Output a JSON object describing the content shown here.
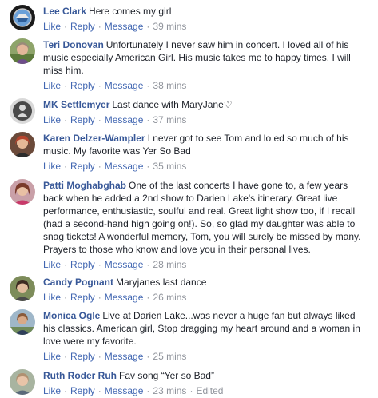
{
  "labels": {
    "like": "Like",
    "reply": "Reply",
    "message": "Message",
    "separator": "·"
  },
  "comments": [
    {
      "author": "Lee Clark",
      "text": "Here comes my girl",
      "time": "39 mins",
      "edited": "",
      "avatar": "lee-clark"
    },
    {
      "author": "Teri Donovan",
      "text": "Unfortunately I never saw him in concert. I loved all of his music especially American Girl. His music takes me to happy times. I will miss him.",
      "time": "38 mins",
      "edited": "",
      "avatar": "teri-donovan"
    },
    {
      "author": "MK Settlemyer",
      "text": "Last dance with MaryJane♡",
      "time": "37 mins",
      "edited": "",
      "avatar": "mk-settlemyer"
    },
    {
      "author": "Karen Delzer-Wampler",
      "text": "I never got to see Tom and lo ed so much of his music. My favorite was Yer So Bad",
      "time": "35 mins",
      "edited": "",
      "avatar": "karen-delzer-wampler"
    },
    {
      "author": "Patti Moghabghab",
      "text": "One of the last concerts I have gone to, a few years back when he added a 2nd show to Darien Lake's itinerary. Great live performance, enthusiastic, soulful and real. Great light show too, if I recall (had a second-hand high going on!). So, so glad my daughter was able to snag tickets! A wonderful memory, Tom, you will surely be missed by many. Prayers to those who know and love you in their personal lives.",
      "time": "28 mins",
      "edited": "",
      "avatar": "patti-moghabghab"
    },
    {
      "author": "Candy Pognant",
      "text": "Maryjanes last dance",
      "time": "26 mins",
      "edited": "",
      "avatar": "candy-pognant"
    },
    {
      "author": "Monica Ogle",
      "text": "Live at Darien Lake...was never a huge fan but always liked his classics. American girl, Stop dragging my heart around and a woman in love were my favorite.",
      "time": "25 mins",
      "edited": "",
      "avatar": "monica-ogle"
    },
    {
      "author": "Ruth Roder Ruh",
      "text": "Fav song “Yer so Bad”",
      "time": "23 mins",
      "edited": "Edited",
      "avatar": "ruth-roder-ruh"
    }
  ]
}
